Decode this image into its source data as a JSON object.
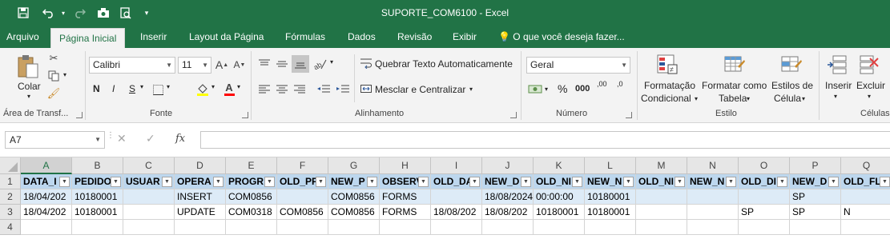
{
  "window": {
    "title": "SUPORTE_COM6100 - Excel",
    "accent_color": "#217346"
  },
  "quick_access": {
    "icons": [
      "save-icon",
      "undo-icon",
      "redo-icon",
      "camera-icon",
      "print-preview-icon",
      "customize-icon"
    ]
  },
  "tabs": [
    {
      "label": "Arquivo"
    },
    {
      "label": "Página Inicial",
      "active": true
    },
    {
      "label": "Inserir"
    },
    {
      "label": "Layout da Página"
    },
    {
      "label": "Fórmulas"
    },
    {
      "label": "Dados"
    },
    {
      "label": "Revisão"
    },
    {
      "label": "Exibir"
    },
    {
      "label": "O que você deseja fazer..."
    }
  ],
  "ribbon": {
    "clipboard": {
      "paste": "Colar",
      "group": "Área de Transf..."
    },
    "font": {
      "name": "Calibri",
      "size": "11",
      "bold": "N",
      "italic": "I",
      "underline": "S",
      "group": "Fonte"
    },
    "alignment": {
      "wrap": "Quebrar Texto Automaticamente",
      "merge": "Mesclar e Centralizar",
      "group": "Alinhamento"
    },
    "number": {
      "format": "Geral",
      "percent": "%",
      "thousands": "000",
      "dec_inc": ",00",
      "dec_dec": ",0",
      "group": "Número"
    },
    "styles": {
      "cond1": "Formatação",
      "cond2": "Condicional",
      "table1": "Formatar como",
      "table2": "Tabela",
      "cell1": "Estilos de",
      "cell2": "Célula",
      "group": "Estilo"
    },
    "cells": {
      "insert": "Inserir",
      "delete": "Excluir",
      "group": "Células"
    }
  },
  "formula_bar": {
    "name_box": "A7",
    "fx": "fx",
    "formula": ""
  },
  "grid": {
    "columns": [
      "A",
      "B",
      "C",
      "D",
      "E",
      "F",
      "G",
      "H",
      "I",
      "J",
      "K",
      "L",
      "M",
      "N",
      "O",
      "P",
      "Q"
    ],
    "selected_column": "A",
    "rows": [
      "1",
      "2",
      "3",
      "4"
    ],
    "header": [
      "DATA_I",
      "PEDIDO",
      "USUAR",
      "OPERA",
      "PROGR",
      "OLD_PF",
      "NEW_P",
      "OBSERV",
      "OLD_DA",
      "NEW_D",
      "OLD_NI",
      "NEW_N",
      "OLD_NI",
      "NEW_N",
      "OLD_DI",
      "NEW_D",
      "OLD_FL"
    ],
    "data": [
      [
        "18/04/202",
        "10180001",
        "",
        "INSERT",
        "COM0856",
        "",
        "COM0856",
        "FORMS",
        "",
        "18/08/2024",
        "00:00:00",
        "10180001",
        "",
        "",
        "",
        "SP",
        ""
      ],
      [
        "18/04/202",
        "10180001",
        "",
        "UPDATE",
        "COM0318",
        "COM0856",
        "COM0856",
        "FORMS",
        "18/08/202",
        "18/08/202",
        "10180001",
        "10180001",
        "",
        "",
        "SP",
        "SP",
        "N"
      ]
    ]
  }
}
